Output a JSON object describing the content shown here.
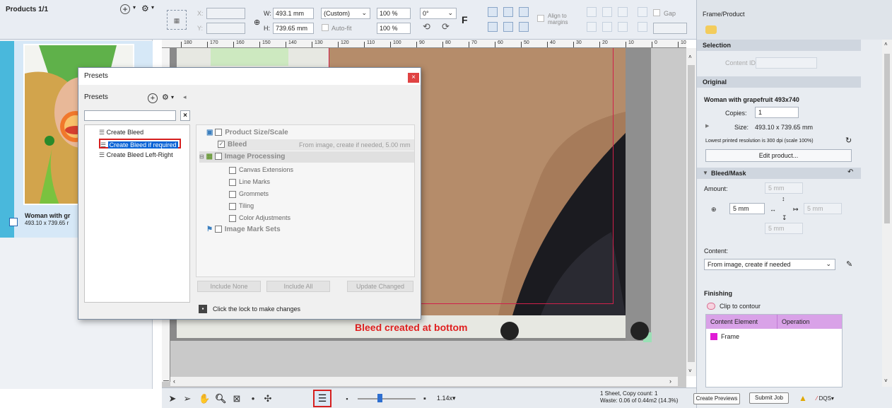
{
  "toolbar": {
    "products_label": "Products 1/1",
    "x_label": "X:",
    "y_label": "Y:",
    "w_label": "W:",
    "h_label": "H:",
    "w_value": "493.1 mm",
    "h_value": "739.65 mm",
    "preset_select": "(Custom)",
    "scale1": "100 %",
    "scale2": "100 %",
    "autofit_label": "Auto-fit",
    "rotation": "0°",
    "f_label": "F",
    "align_margins_label": "Align to margins",
    "gap_label": "Gap"
  },
  "left_panel": {
    "product_name": "Woman with gr",
    "product_size": "493.10 x 739.65 r"
  },
  "ruler_ticks": [
    "180",
    "170",
    "160",
    "150",
    "140",
    "130",
    "120",
    "110",
    "100",
    "90",
    "80",
    "70",
    "60",
    "50",
    "40",
    "30",
    "20",
    "10",
    "0",
    "10"
  ],
  "canvas": {
    "caption": "Bleed created at bottom"
  },
  "dialog": {
    "title": "Presets",
    "close": "×",
    "presets_label": "Presets",
    "search_clear": "×",
    "tree": [
      "Create Bleed",
      "Create Bleed if required",
      "Create Bleed Left-Right"
    ],
    "options": {
      "product_size": "Product Size/Scale",
      "bleed": "Bleed",
      "bleed_desc": "From image, create if needed, 5.00 mm",
      "image_processing": "Image Processing",
      "canvas_ext": "Canvas Extensions",
      "line_marks": "Line Marks",
      "grommets": "Grommets",
      "tiling": "Tiling",
      "color_adj": "Color Adjustments",
      "image_mark_sets": "Image Mark Sets"
    },
    "buttons": {
      "include_none": "Include None",
      "include_all": "Include All",
      "update_changed": "Update Changed"
    },
    "lock_text": "Click the lock to make changes"
  },
  "right_panel": {
    "tab_label": "Frame/Product",
    "selection_header": "Selection",
    "content_id_label": "Content ID",
    "original_header": "Original",
    "original_name": "Woman with grapefruit 493x740",
    "copies_label": "Copies:",
    "copies_value": "1",
    "size_label": "Size:",
    "size_value": "493.10 x 739.65 mm",
    "resolution_note": "Lowest printed resolution is 300 dpi (scale 100%)",
    "edit_product": "Edit product...",
    "bleed_header": "Bleed/Mask",
    "amount_label": "Amount:",
    "amount_top": "5 mm",
    "amount_left": "5 mm",
    "amount_right": "5 mm",
    "amount_bottom": "5 mm",
    "content_label": "Content:",
    "content_value": "From image, create if needed",
    "finishing_header": "Finishing",
    "clip_label": "Clip to contour",
    "col_content": "Content Element",
    "col_operation": "Operation",
    "row_frame": "Frame"
  },
  "status": {
    "zoom": "1.14x",
    "sheet_info": "1 Sheet, Copy count: 1",
    "waste_info": "Waste: 0.06 of 0.44m2 (14.3%)",
    "create_previews": "Create Previews",
    "submit_job": "Submit Job",
    "dqs": "DQS"
  },
  "colors": {
    "accent_red": "#e02020",
    "selection_blue": "#0a64d6",
    "table_header": "#d9a2e8",
    "frame_magenta": "#e01bd5"
  }
}
